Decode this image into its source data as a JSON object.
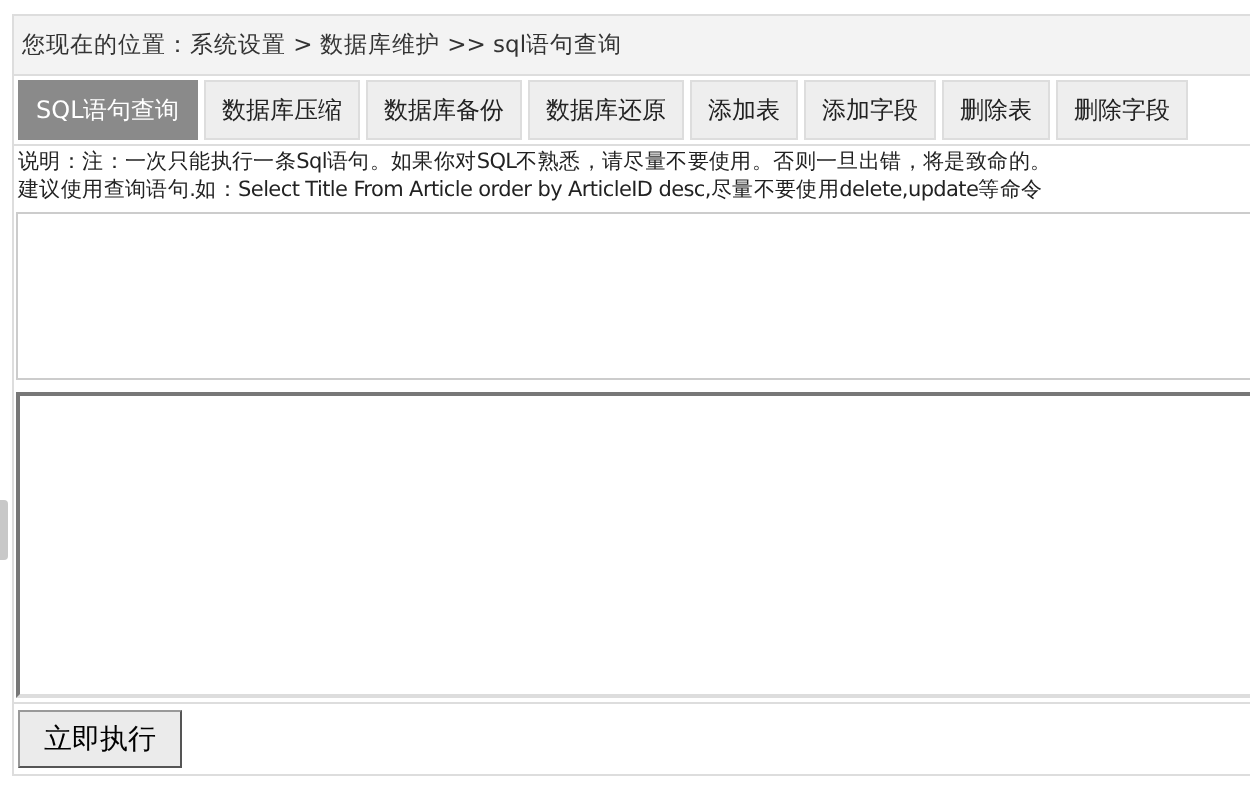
{
  "breadcrumb": "您现在的位置：系统设置 > 数据库维护 >> sql语句查询",
  "tabs": [
    {
      "label": "SQL语句查询",
      "selected": true
    },
    {
      "label": "数据库压缩",
      "selected": false
    },
    {
      "label": "数据库备份",
      "selected": false
    },
    {
      "label": "数据库还原",
      "selected": false
    },
    {
      "label": "添加表",
      "selected": false
    },
    {
      "label": "添加字段",
      "selected": false
    },
    {
      "label": "删除表",
      "selected": false
    },
    {
      "label": "删除字段",
      "selected": false
    }
  ],
  "notes": [
    "说明：注：一次只能执行一条Sql语句。如果你对SQL不熟悉，请尽量不要使用。否则一旦出错，将是致命的。",
    "建议使用查询语句.如：Select Title From Article order by ArticleID desc,尽量不要使用delete,update等命令"
  ],
  "execute_button": "立即执行"
}
